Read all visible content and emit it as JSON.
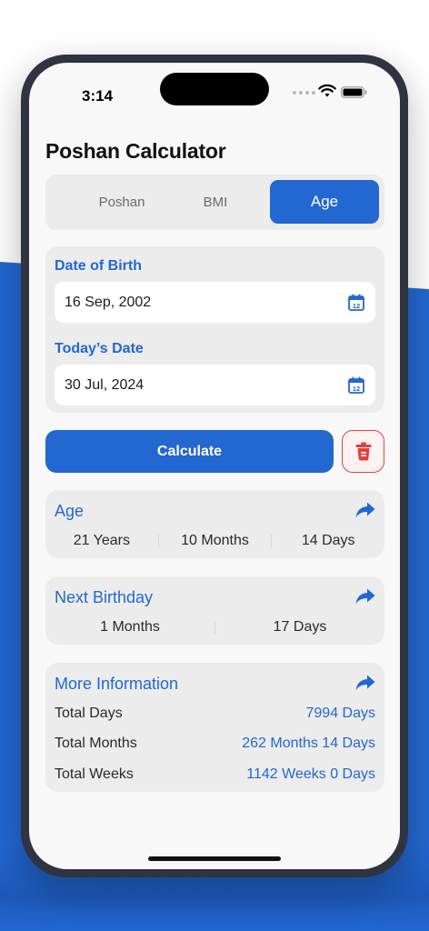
{
  "status": {
    "time": "3:14"
  },
  "app": {
    "title": "Poshan Calculator"
  },
  "tabs": [
    {
      "label": "Poshan",
      "active": false
    },
    {
      "label": "BMI",
      "active": false
    },
    {
      "label": "Age",
      "active": true
    }
  ],
  "dates": {
    "dob_label": "Date of Birth",
    "dob_value": "16 Sep, 2002",
    "today_label": "Today’s Date",
    "today_value": "30 Jul, 2024",
    "calendar_icon_text": "12"
  },
  "actions": {
    "calculate": "Calculate"
  },
  "age": {
    "title": "Age",
    "years": "21 Years",
    "months": "10 Months",
    "days": "14 Days"
  },
  "next_birthday": {
    "title": "Next Birthday",
    "months": "1 Months",
    "days": "17 Days"
  },
  "more_info": {
    "title": "More Information",
    "rows": [
      {
        "label": "Total Days",
        "value": "7994 Days"
      },
      {
        "label": "Total Months",
        "value": "262 Months 14 Days"
      },
      {
        "label": "Total Weeks",
        "value": "1142 Weeks 0 Days"
      }
    ]
  },
  "colors": {
    "accent": "#2367d1",
    "danger": "#e14040",
    "card_bg": "#ececec",
    "screen_bg": "#f8f8f8"
  },
  "icons": {
    "calendar": "calendar-icon",
    "trash": "trash-icon",
    "share": "share-arrow-icon",
    "wifi": "wifi-icon",
    "battery": "battery-icon"
  }
}
